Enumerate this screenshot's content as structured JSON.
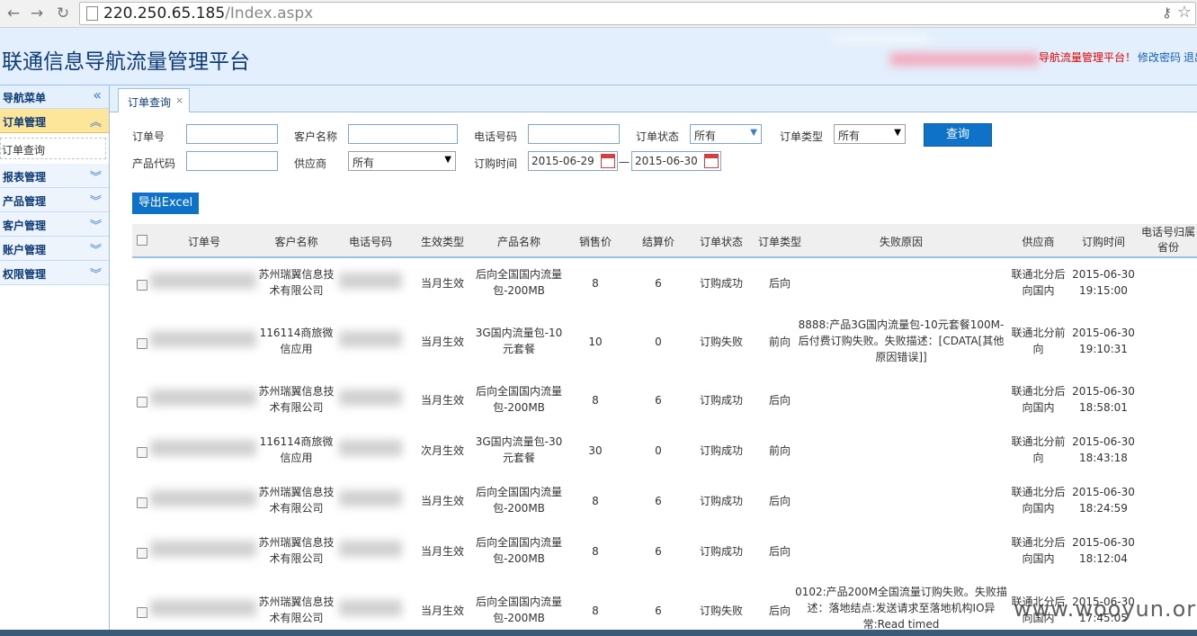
{
  "browser": {
    "back_icon": "back-arrow-icon",
    "forward_icon": "forward-arrow-icon",
    "reload_icon": "reload-icon",
    "url_host": "220.250.65.185",
    "url_path": "/Index.aspx"
  },
  "header": {
    "app_title": "联通信息导航流量管理平台",
    "welcome_text": "导航流量管理平台！",
    "change_password": "修改密码",
    "logout": "退出"
  },
  "sidebar": {
    "title": "导航菜单",
    "groups": [
      {
        "label": "订单管理",
        "active": true,
        "items": [
          {
            "label": "订单查询"
          }
        ]
      },
      {
        "label": "报表管理"
      },
      {
        "label": "产品管理"
      },
      {
        "label": "客户管理"
      },
      {
        "label": "账户管理"
      },
      {
        "label": "权限管理"
      }
    ]
  },
  "tabs": [
    {
      "label": "订单查询",
      "close": "×"
    }
  ],
  "filters": {
    "order_no_label": "订单号",
    "order_no_value": "",
    "customer_label": "客户名称",
    "customer_value": "",
    "phone_label": "电话号码",
    "phone_value": "",
    "status_label": "订单状态",
    "status_value": "所有",
    "type_label": "订单类型",
    "type_value": "所有",
    "product_code_label": "产品代码",
    "product_code_value": "",
    "supplier_label": "供应商",
    "supplier_value": "所有",
    "order_time_label": "订购时间",
    "date_from": "2015-06-29",
    "date_sep": "—",
    "date_to": "2015-06-30",
    "query_button": "查询",
    "export_button": "导出Excel"
  },
  "table": {
    "columns": [
      "订单号",
      "客户名称",
      "电话号码",
      "生效类型",
      "产品名称",
      "销售价",
      "结算价",
      "订单状态",
      "订单类型",
      "失败原因",
      "供应商",
      "订购时间",
      "电话号归属省份"
    ],
    "rows": [
      {
        "order_no": "",
        "customer": "苏州瑞翼信息技术有限公司",
        "phone": "",
        "effect": "当月生效",
        "product": "后向全国国内流量包-200MB",
        "sale": "8",
        "settle": "6",
        "status": "订购成功",
        "type": "后向",
        "reason": "",
        "supplier": "联通北分后向国内",
        "time_date": "2015-06-30",
        "time_clock": "19:15:00",
        "province": ""
      },
      {
        "order_no": "151···265",
        "customer": "116114商旅微信应用",
        "phone": "",
        "effect": "当月生效",
        "product": "3G国内流量包-10元套餐",
        "sale": "10",
        "settle": "0",
        "status": "订购失败",
        "type": "前向",
        "reason": "8888:产品3G国内流量包-10元套餐100M-后付费订购失败。失败描述：[CDATA[其他原因错误]]",
        "supplier": "联通北分前向",
        "time_date": "2015-06-30",
        "time_clock": "19:10:31",
        "province": ""
      },
      {
        "order_no": "···37",
        "customer": "苏州瑞翼信息技术有限公司",
        "phone": "···6",
        "effect": "当月生效",
        "product": "后向全国国内流量包-200MB",
        "sale": "8",
        "settle": "6",
        "status": "订购成功",
        "type": "后向",
        "reason": "",
        "supplier": "联通北分后向国内",
        "time_date": "2015-06-30",
        "time_clock": "18:58:01",
        "province": ""
      },
      {
        "order_no": "",
        "customer": "116114商旅微信应用",
        "phone": "",
        "effect": "次月生效",
        "product": "3G国内流量包-30元套餐",
        "sale": "30",
        "settle": "0",
        "status": "订购成功",
        "type": "前向",
        "reason": "",
        "supplier": "联通北分前向",
        "time_date": "2015-06-30",
        "time_clock": "18:43:18",
        "province": ""
      },
      {
        "order_no": "···",
        "customer": "苏州瑞翼信息技术有限公司",
        "phone": "",
        "effect": "当月生效",
        "product": "后向全国国内流量包-200MB",
        "sale": "8",
        "settle": "6",
        "status": "订购成功",
        "type": "后向",
        "reason": "",
        "supplier": "联通北分后向国内",
        "time_date": "2015-06-30",
        "time_clock": "18:24:59",
        "province": ""
      },
      {
        "order_no": "···1459",
        "customer": "苏州瑞翼信息技术有限公司",
        "phone": "",
        "effect": "当月生效",
        "product": "后向全国国内流量包-200MB",
        "sale": "8",
        "settle": "6",
        "status": "订购成功",
        "type": "后向",
        "reason": "",
        "supplier": "联通北分后向国内",
        "time_date": "2015-06-30",
        "time_clock": "18:12:04",
        "province": ""
      },
      {
        "order_no": "···939",
        "customer": "苏州瑞翼信息技术有限公司",
        "phone": "",
        "effect": "当月生效",
        "product": "后向全国国内流量包-200MB",
        "sale": "8",
        "settle": "6",
        "status": "订购失败",
        "type": "后向",
        "reason": "0102:产品200M全国流量订购失败。失败描述：落地结点:发送请求至落地机构IO异常:Read timed",
        "supplier": "联通北分后向国内",
        "time_date": "2015-06-30",
        "time_clock": "17:45:05",
        "province": ""
      }
    ]
  },
  "watermark": "www.wooyun.org",
  "colors": {
    "header_bg": "#e3effd",
    "button_blue": "#0d72c8",
    "active_menu": "#fde59a",
    "title_blue": "#0d3b75"
  }
}
